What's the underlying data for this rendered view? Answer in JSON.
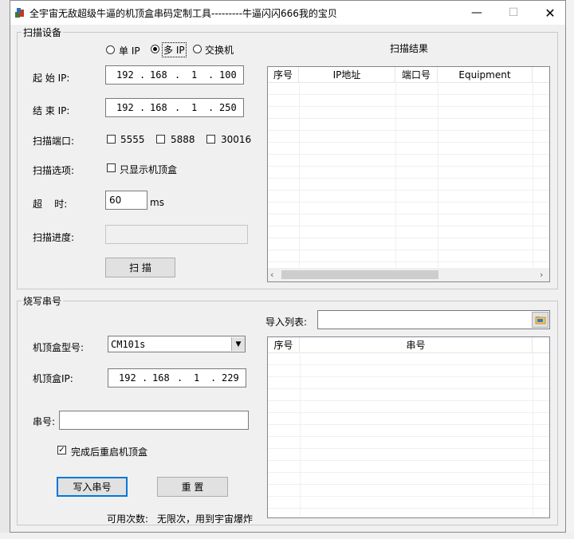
{
  "window": {
    "title": "全宇宙无敌超级牛逼的机顶盒串码定制工具---------牛逼闪闪666我的宝贝",
    "minimize": "—",
    "maximize": "☐",
    "close": "✕"
  },
  "scan": {
    "group_label": "扫描设备",
    "modes": [
      {
        "label": "单 IP",
        "selected": false
      },
      {
        "label": "多 IP",
        "selected": true
      },
      {
        "label": "交换机",
        "selected": false
      }
    ],
    "start_ip_label": "起 始 IP:",
    "start_ip": [
      "192",
      "168",
      "1",
      "100"
    ],
    "end_ip_label": "结 束 IP:",
    "end_ip": [
      "192",
      "168",
      "1",
      "250"
    ],
    "port_label": "扫描端口:",
    "ports": [
      {
        "label": "5555",
        "checked": false
      },
      {
        "label": "5888",
        "checked": false
      },
      {
        "label": "30016",
        "checked": false
      }
    ],
    "option_label": "扫描选项:",
    "option_checkbox": "只显示机顶盒",
    "timeout_label": "超    时:",
    "timeout_value": "60",
    "timeout_unit": "ms",
    "progress_label": "扫描进度:",
    "progress": 0,
    "scan_button": "扫  描",
    "results_label": "扫描结果",
    "results_columns": [
      "序号",
      "IP地址",
      "端口号",
      "Equipment"
    ]
  },
  "burn": {
    "group_label": "烧写串号",
    "import_label": "导入列表:",
    "import_value": "",
    "model_label": "机顶盒型号:",
    "model_value": "CM101s",
    "ip_label": "机顶盒IP:",
    "ip": [
      "192",
      "168",
      "1",
      "229"
    ],
    "serial_label": "串号:",
    "serial_value": "",
    "reboot_checkbox": "完成后重启机顶盒",
    "reboot_checked": true,
    "write_button": "写入串号",
    "reset_button": "重  置",
    "usage_label": "可用次数:",
    "usage_value": "无限次，用到宇宙爆炸",
    "list_columns": [
      "序号",
      "串号"
    ]
  }
}
